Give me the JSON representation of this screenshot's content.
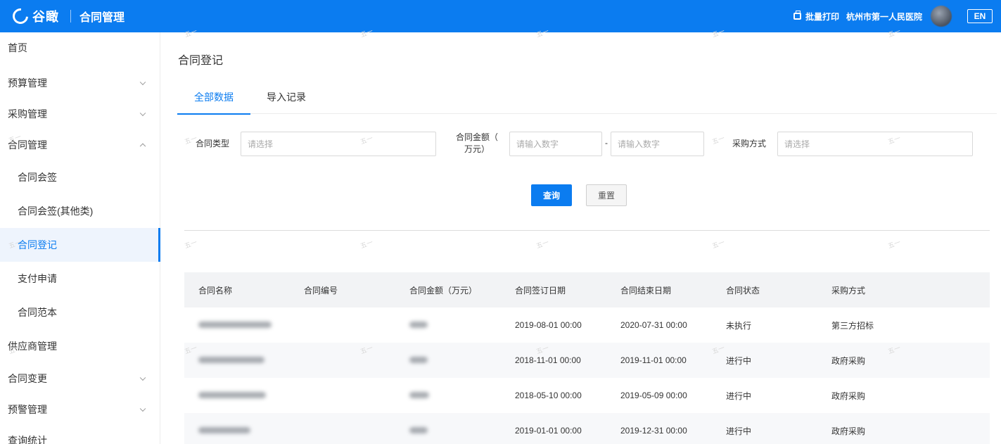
{
  "header": {
    "logo_text": "谷瞰",
    "app_title": "合同管理",
    "print_label": "批量打印",
    "hospital": "杭州市第一人民医院",
    "lang": "EN"
  },
  "sidebar": {
    "items": [
      {
        "label": "首页"
      },
      {
        "label": "预算管理"
      },
      {
        "label": "采购管理"
      },
      {
        "label": "合同管理"
      },
      {
        "label": "合同会签"
      },
      {
        "label": "合同会签(其他类)"
      },
      {
        "label": "合同登记"
      },
      {
        "label": "支付申请"
      },
      {
        "label": "合同范本"
      },
      {
        "label": "供应商管理"
      },
      {
        "label": "合同变更"
      },
      {
        "label": "预警管理"
      },
      {
        "label": "查询统计"
      }
    ]
  },
  "page": {
    "title": "合同登记",
    "tabs": [
      "全部数据",
      "导入记录"
    ]
  },
  "filters": {
    "type_label": "合同类型",
    "type_placeholder": "请选择",
    "amount_label_1": "合同金额（",
    "amount_label_2": "万元）",
    "amount_min_placeholder": "请输入数字",
    "amount_max_placeholder": "请输入数字",
    "dash": "-",
    "method_label": "采购方式",
    "method_placeholder": "请选择",
    "query_label": "查询",
    "reset_label": "重置"
  },
  "table": {
    "headers": [
      "合同名称",
      "合同编号",
      "合同金额（万元）",
      "合同签订日期",
      "合同结束日期",
      "合同状态",
      "采购方式"
    ],
    "rows": [
      {
        "sign_date": "2019-08-01 00:00",
        "end_date": "2020-07-31 00:00",
        "status": "未执行",
        "method": "第三方招标"
      },
      {
        "sign_date": "2018-11-01 00:00",
        "end_date": "2019-11-01 00:00",
        "status": "进行中",
        "method": "政府采购"
      },
      {
        "sign_date": "2018-05-10 00:00",
        "end_date": "2019-05-09 00:00",
        "status": "进行中",
        "method": "政府采购"
      },
      {
        "sign_date": "2019-01-01 00:00",
        "end_date": "2019-12-31 00:00",
        "status": "进行中",
        "method": "政府采购"
      }
    ]
  },
  "watermark_text": "五一"
}
